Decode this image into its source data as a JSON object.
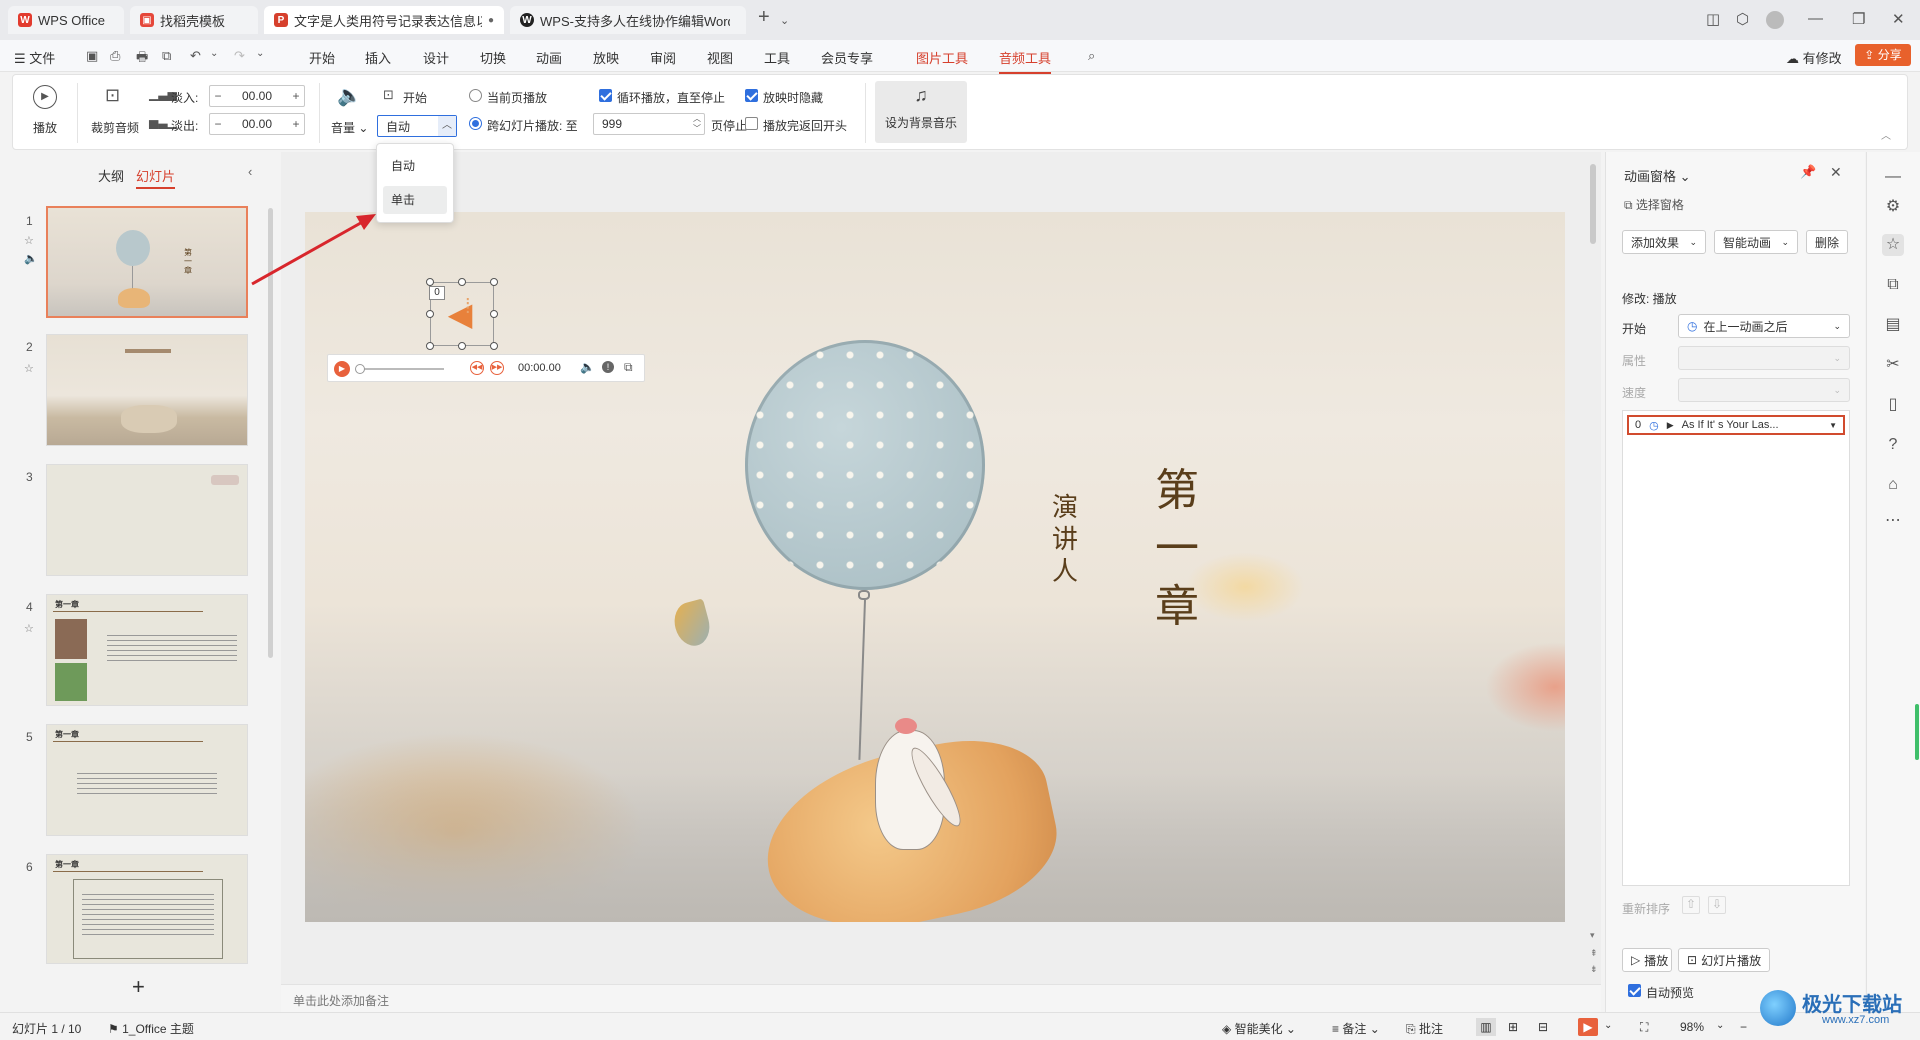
{
  "tabs": [
    {
      "label": "WPS Office",
      "icon": "wps-logo-icon"
    },
    {
      "label": "找稻壳模板",
      "icon": "docer-icon"
    },
    {
      "label": "文字是人类用符号记录表达信息以",
      "icon": "ppt-file-icon"
    },
    {
      "label": "WPS-支持多人在线协作编辑Word、",
      "icon": "wps-web-icon"
    }
  ],
  "menu": {
    "file": "文件",
    "items": [
      "开始",
      "插入",
      "设计",
      "切换",
      "动画",
      "放映",
      "审阅",
      "视图",
      "工具",
      "会员专享"
    ],
    "picture_tools": "图片工具",
    "audio_tools": "音频工具",
    "has_changes": "有修改",
    "share": "分享"
  },
  "ribbon": {
    "play": "播放",
    "trim_audio": "裁剪音频",
    "fade_in_label": "淡入:",
    "fade_in_value": "00.00",
    "fade_out_label": "淡出:",
    "fade_out_value": "00.00",
    "volume": "音量",
    "start_label": "开始",
    "start_value": "自动",
    "current_page_play": "当前页播放",
    "cross_slide_play": "跨幻灯片播放: 至",
    "cross_slide_value": "999",
    "page_stop": "页停止",
    "loop_play": "循环播放，直至停止",
    "hide_when_playing": "放映时隐藏",
    "rewind_after_play": "播放完返回开头",
    "set_bg_music": "设为背景音乐"
  },
  "dropdown": {
    "options": [
      "自动",
      "单击"
    ],
    "highlighted": "单击"
  },
  "left_panel": {
    "outline_tab": "大纲",
    "slides_tab": "幻灯片",
    "slide_numbers": [
      "1",
      "2",
      "3",
      "4",
      "5",
      "6"
    ],
    "thumb_titles": [
      "第一章",
      "第一章",
      "第一章"
    ],
    "add": "+"
  },
  "slide": {
    "chapter_text": "第一章",
    "chars_big": [
      "第",
      "一",
      "章"
    ],
    "chars_small": [
      "演",
      "讲",
      "人"
    ],
    "audio_marker": "0",
    "audio_time": "00:00.00"
  },
  "notes_placeholder": "单击此处添加备注",
  "anim_pane": {
    "title": "动画窗格",
    "select_pane": "选择窗格",
    "add_effect": "添加效果",
    "smart_anim": "智能动画",
    "delete": "删除",
    "modify": "修改: 播放",
    "start_label": "开始",
    "start_value": "在上一动画之后",
    "property_label": "属性",
    "speed_label": "速度",
    "item_index": "0",
    "item_name": "As If It' s Your Las...",
    "reorder": "重新排序",
    "play_btn": "播放",
    "slideshow_btn": "幻灯片播放",
    "auto_preview": "自动预览"
  },
  "status": {
    "slide_info": "幻灯片 1 / 10",
    "theme": "1_Office 主题",
    "smart_beautify": "智能美化",
    "notes": "备注",
    "comments": "批注",
    "zoom": "98%"
  },
  "watermark": {
    "text": "极光下载站",
    "url": "www.xz7.com"
  },
  "colors": {
    "accent": "#d6402d",
    "selection": "#2f6fde",
    "chapter_text": "#5a3e1b"
  }
}
